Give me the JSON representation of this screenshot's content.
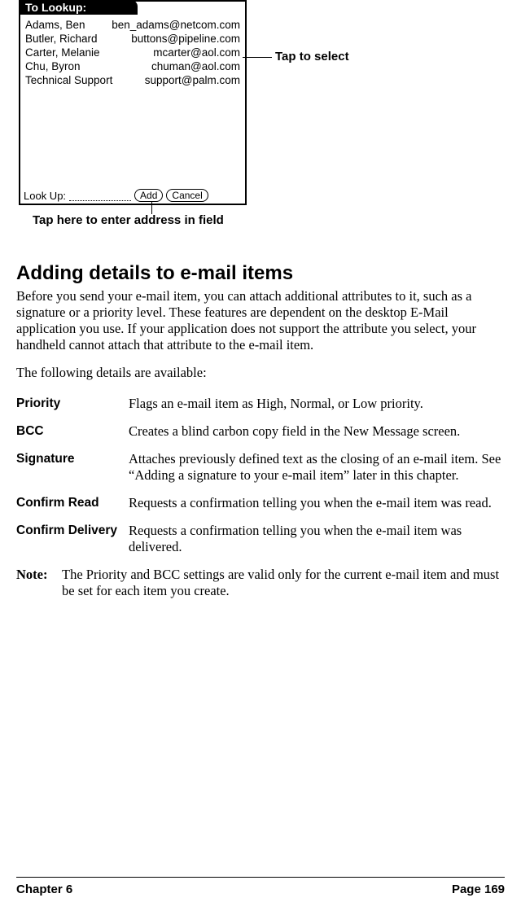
{
  "palm": {
    "title": "To Lookup:",
    "rows": [
      {
        "name": "Adams, Ben",
        "email": "ben_adams@netcom.com"
      },
      {
        "name": "Butler, Richard",
        "email": "buttons@pipeline.com"
      },
      {
        "name": "Carter, Melanie",
        "email": "mcarter@aol.com"
      },
      {
        "name": "Chu, Byron",
        "email": "chuman@aol.com"
      },
      {
        "name": "Technical Support",
        "email": "support@palm.com"
      }
    ],
    "lookup_label": "Look Up:",
    "add_btn": "Add",
    "cancel_btn": "Cancel"
  },
  "callouts": {
    "tap_select": "Tap to select",
    "tap_here": "Tap here to enter address in field"
  },
  "section_heading": "Adding details to e-mail items",
  "para1": "Before you send your e-mail item, you can attach additional attributes to it, such as a signature or a priority level. These features are dependent on the desktop E-Mail application you use. If your application does not support the attribute you select, your handheld cannot attach that attribute to the e-mail item.",
  "para2": "The following details are available:",
  "defs": [
    {
      "term": "Priority",
      "desc": "Flags an e-mail item as High, Normal, or Low priority."
    },
    {
      "term": "BCC",
      "desc": "Creates a blind carbon copy field in the New Message screen."
    },
    {
      "term": "Signature",
      "desc": "Attaches previously defined text as the closing of an e-mail item. See “Adding a signature to your e-mail item” later in this chapter."
    },
    {
      "term": "Confirm Read",
      "desc": "Requests a confirmation telling you when the e-mail item was read."
    },
    {
      "term": "Confirm Delivery",
      "desc": "Requests a confirmation telling you when the e-mail item was delivered."
    }
  ],
  "note": {
    "label": "Note:",
    "text": "The Priority and BCC settings are valid only for the current e-mail item and must be set for each item you create."
  },
  "footer": {
    "left": "Chapter 6",
    "right": "Page 169"
  }
}
